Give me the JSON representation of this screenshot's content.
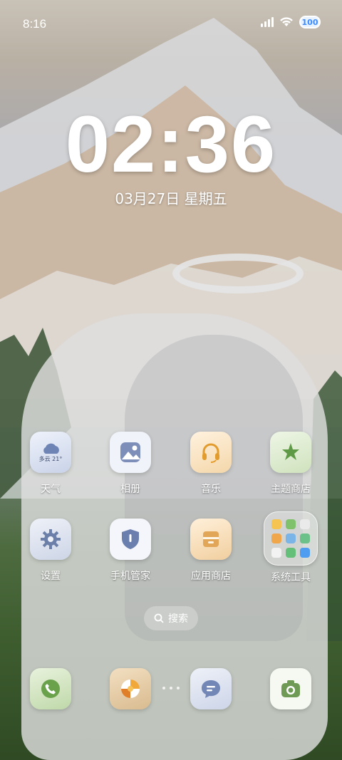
{
  "status_bar": {
    "time": "8:16",
    "battery": "100"
  },
  "lock": {
    "clock": "02:36",
    "date": "03月27日 星期五"
  },
  "apps": [
    {
      "label": "天气",
      "icon": "weather-icon",
      "badge": "多云 21°"
    },
    {
      "label": "相册",
      "icon": "gallery-icon"
    },
    {
      "label": "音乐",
      "icon": "headphones-icon"
    },
    {
      "label": "主题商店",
      "icon": "theme-store-icon"
    },
    {
      "label": "设置",
      "icon": "gear-icon"
    },
    {
      "label": "手机管家",
      "icon": "shield-icon"
    },
    {
      "label": "应用商店",
      "icon": "app-store-icon"
    },
    {
      "label": "系统工具",
      "icon": "folder-icon"
    }
  ],
  "search": {
    "label": "搜索"
  },
  "dock": [
    {
      "icon": "phone-icon"
    },
    {
      "icon": "browser-icon"
    },
    {
      "icon": "message-icon"
    },
    {
      "icon": "camera-icon"
    }
  ],
  "colors": {
    "accent": "#3c8cff",
    "weather_icon_bg": "#d6dff0",
    "music_icon_bg": "#f8e2c4",
    "theme_icon_bg": "#dbe9cf"
  }
}
